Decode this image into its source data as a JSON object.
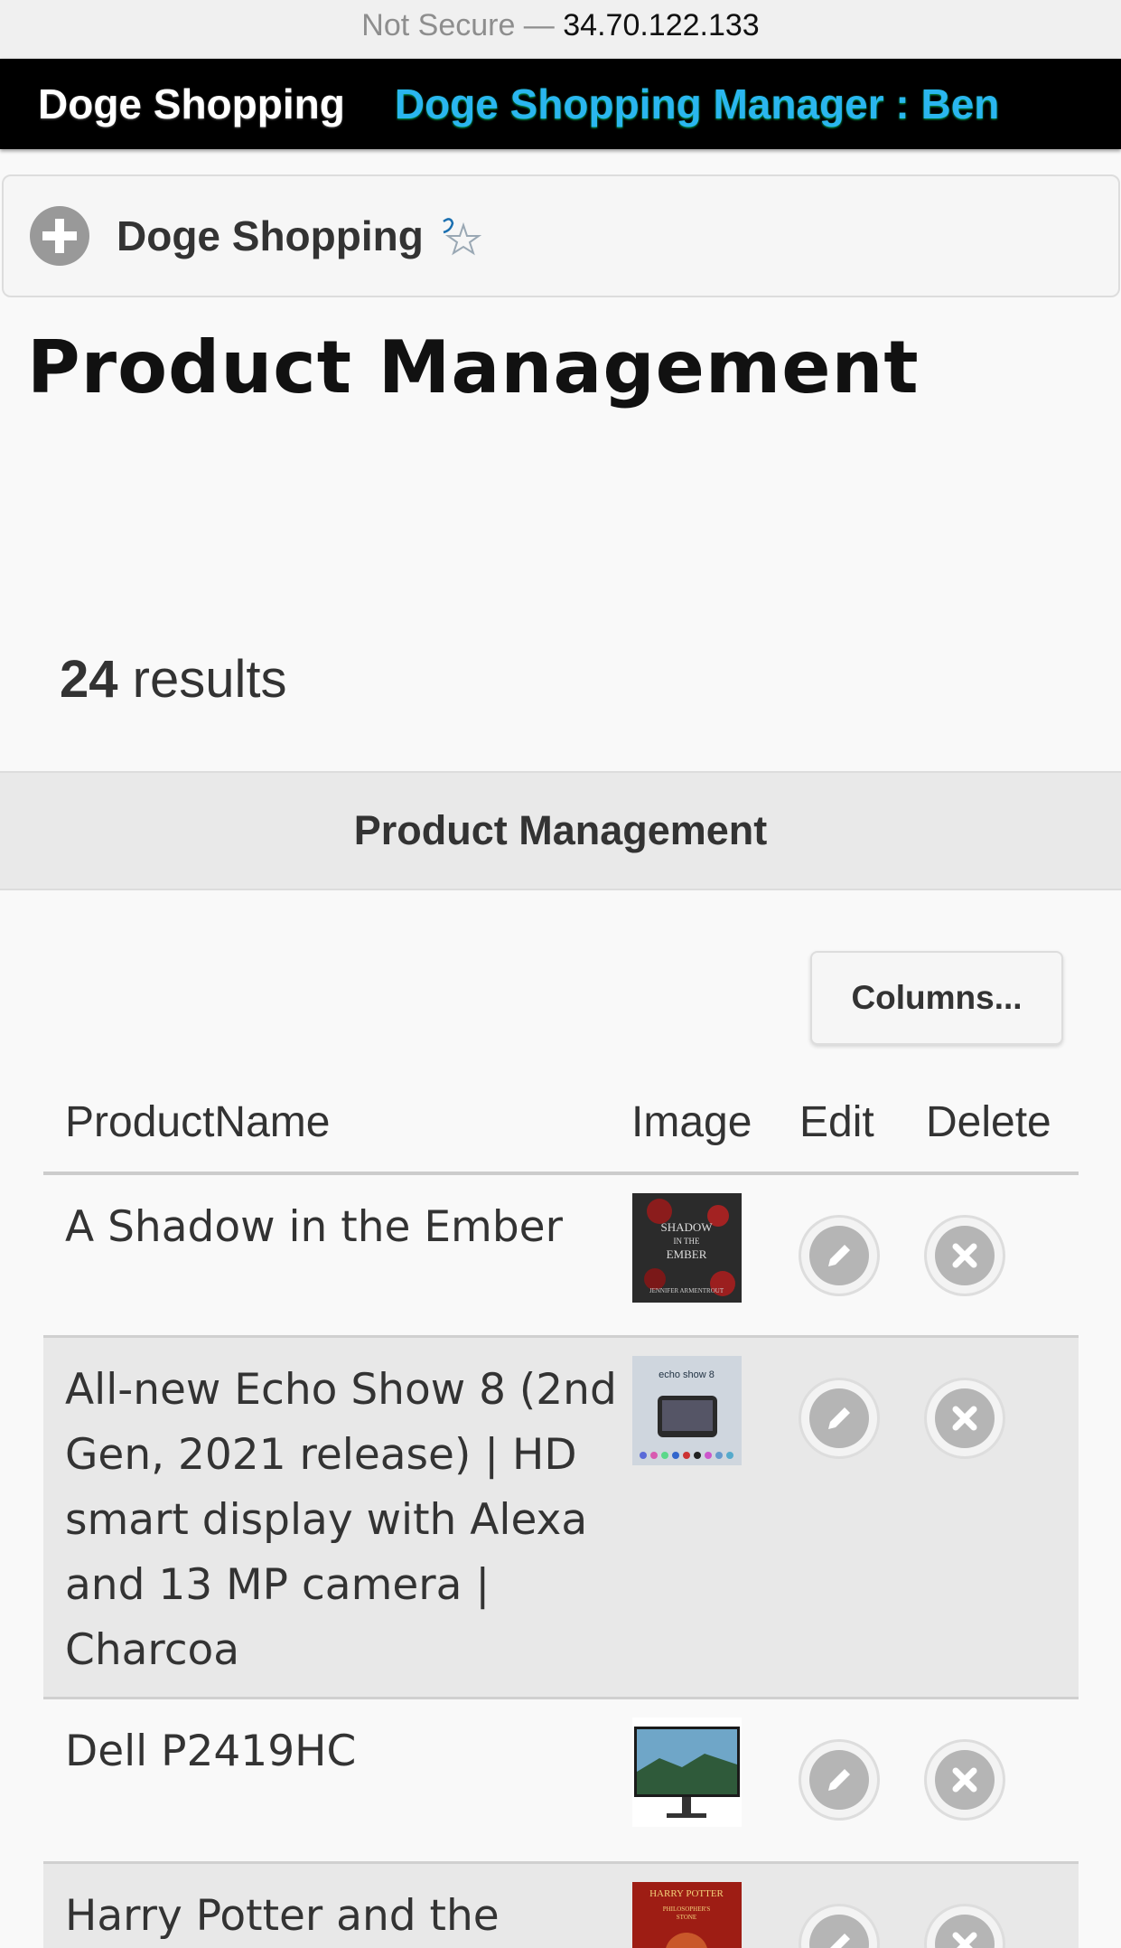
{
  "urlbar": {
    "not_secure": "Not Secure —",
    "host": "34.70.122.133"
  },
  "topnav": {
    "brand": "Doge Shopping",
    "manager": "Doge Shopping Manager : Ben"
  },
  "header": {
    "title": "Doge Shopping"
  },
  "page_title": "Product Management",
  "results": {
    "count": "24",
    "label": "results"
  },
  "section_title": "Product Management",
  "columns_button": "Columns...",
  "table": {
    "headers": {
      "name": "ProductName",
      "image": "Image",
      "edit": "Edit",
      "delete": "Delete"
    },
    "rows": [
      {
        "name": "A Shadow in the Ember"
      },
      {
        "name": "All-new Echo Show 8 (2nd Gen, 2021 release) | HD smart display with Alexa and 13 MP camera | Charcoa"
      },
      {
        "name": "Dell P2419HC"
      },
      {
        "name": "Harry Potter and the"
      }
    ]
  },
  "thumbs": {
    "book1": {
      "line1": "SHADOW",
      "line2": "IN THE",
      "line3": "EMBER",
      "author": "JENNIFER ARMENTROUT"
    },
    "echo": {
      "title": "echo show 8"
    },
    "hp": {
      "line1": "HARRY POTTER",
      "line2": "PHILOSOPHER'S",
      "line3": "STONE"
    }
  }
}
